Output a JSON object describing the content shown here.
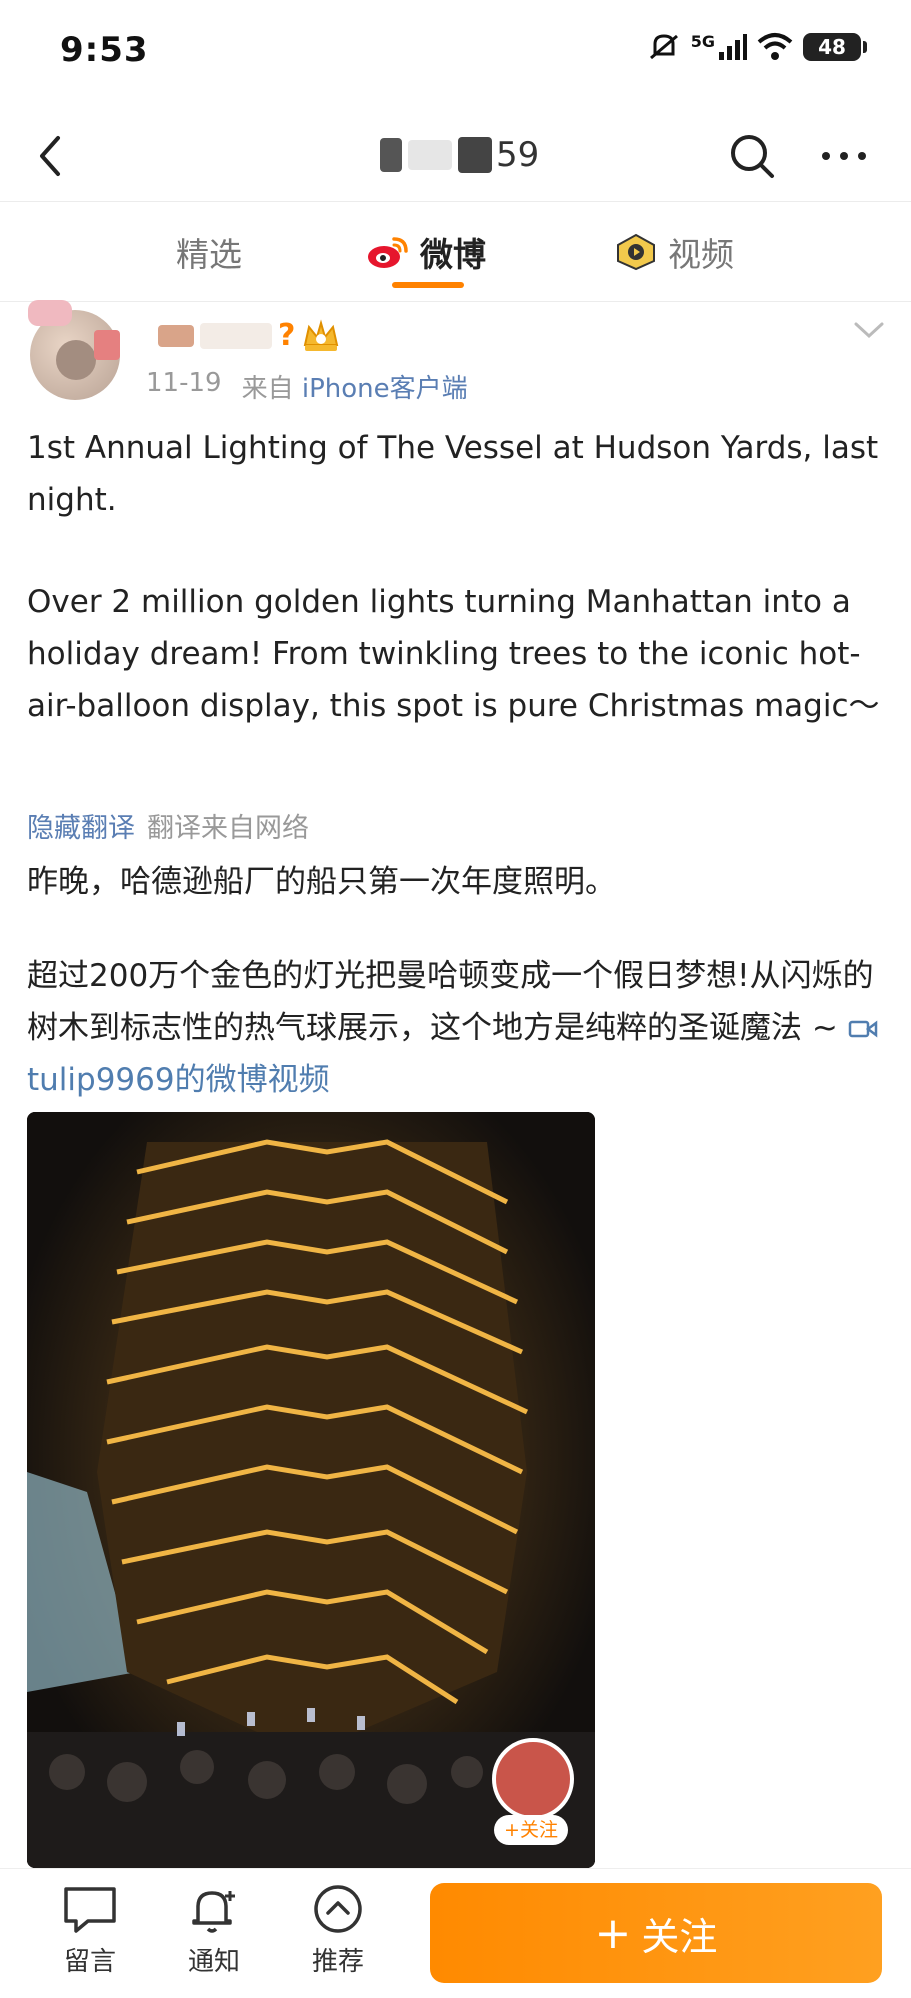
{
  "status_bar": {
    "time": "9:53",
    "network": "5G",
    "battery": "48",
    "icons": [
      "mute-icon",
      "signal-icon",
      "wifi-icon",
      "battery-icon"
    ]
  },
  "nav": {
    "title_suffix": "59",
    "icons": [
      "back-icon",
      "search-icon",
      "more-icon"
    ]
  },
  "tabs": [
    {
      "label": "精选",
      "active": false
    },
    {
      "label": "微博",
      "active": true,
      "icon": "weibo-icon"
    },
    {
      "label": "视频",
      "active": false,
      "icon": "video-icon"
    }
  ],
  "accent_color": "#ff8200",
  "post": {
    "user_suffix": "?",
    "date": "11-19",
    "source_prefix": "来自",
    "source": "iPhone客户端",
    "text_en_1": "1st Annual Lighting of The Vessel at Hudson Yards, last night.",
    "text_en_2": "Over 2 million golden lights turning Manhattan into a holiday dream! From twinkling trees to the iconic hot-air-balloon display, this spot is pure Christmas magic～",
    "hide_translation": "隐藏翻译",
    "translation_source": "翻译来自网络",
    "text_zh_1": "昨晚，哈德逊船厂的船只第一次年度照明。",
    "text_zh_2": "超过200万个金色的灯光把曼哈顿变成一个假日梦想!从闪烁的树木到标志性的热气球展示，这个地方是纯粹的圣诞魔法 ~",
    "video_link": "tulip9969的微博视频",
    "follow_small": "+关注"
  },
  "bottom_bar": {
    "comment_label": "留言",
    "notify_label": "通知",
    "recommend_label": "推荐",
    "follow_label": "关注",
    "follow_plus": "+"
  }
}
